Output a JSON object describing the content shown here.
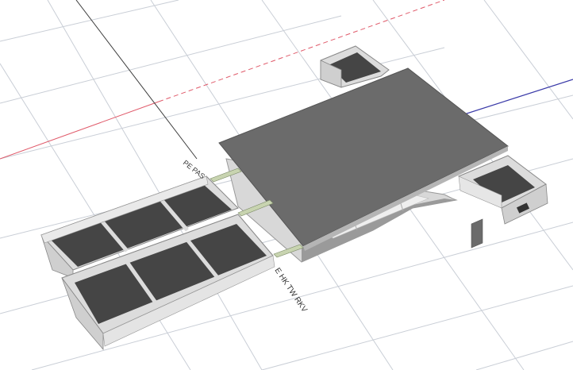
{
  "viewport": {
    "background": "#ffffff",
    "grid_color": "#c9ced6",
    "axis_red": "#e05a6a",
    "axis_blue": "#3a3aa8",
    "axis_dark": "#3c3c3c"
  },
  "model": {
    "top_panel_color": "#6b6b6b",
    "drawer_floor_color": "#454545",
    "drawer_wall_color": "#dcdcdc",
    "rail_color": "#c8d4b0"
  },
  "labels": {
    "rail_label_1": "PE PAS",
    "rail_label_2": "E HK TW RKV"
  }
}
